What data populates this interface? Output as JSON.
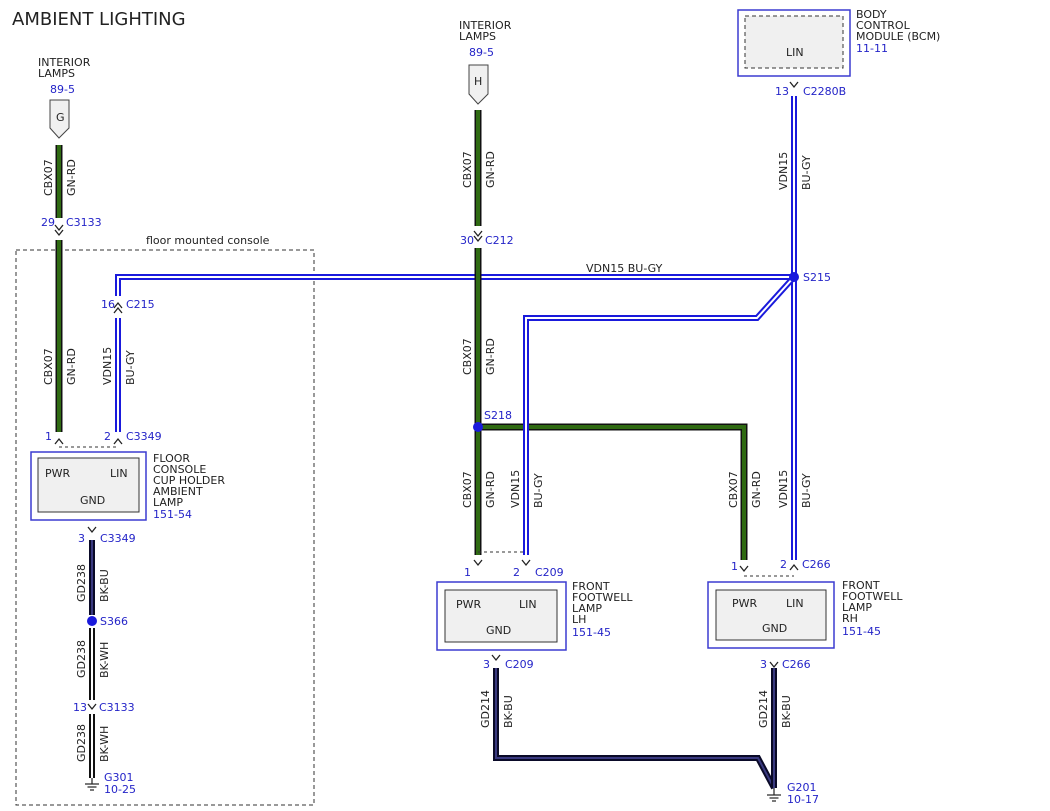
{
  "title": "AMBIENT LIGHTING",
  "colors": {
    "green_red_wire": "#2f6a12",
    "blue_gray_wire": "#1a1adc",
    "black_wire": "#0a0a28",
    "ref_blue": "#2424c8",
    "box_fill": "#f0f0f0",
    "module_border": "#3b3bd0"
  },
  "console_region": {
    "label": "floor mounted console"
  },
  "sources": {
    "left": {
      "name_line1": "INTERIOR",
      "name_line2": "LAMPS",
      "ref": "89-5",
      "pin": "G"
    },
    "mid": {
      "name_line1": "INTERIOR",
      "name_line2": "LAMPS",
      "ref": "89-5",
      "pin": "H"
    },
    "bcm": {
      "name_line1": "BODY",
      "name_line2": "CONTROL",
      "name_line3": "MODULE (BCM)",
      "ref": "11-11",
      "pin": "LIN"
    }
  },
  "connectors": {
    "c3133_top": {
      "pin": "29",
      "name": "C3133"
    },
    "c212": {
      "pin": "30",
      "name": "C212"
    },
    "c2280b": {
      "pin": "13",
      "name": "C2280B"
    },
    "c215": {
      "pin": "16",
      "name": "C215"
    },
    "c3349_pwr": {
      "pin": "1"
    },
    "c3349_lin": {
      "pin": "2",
      "name": "C3349"
    },
    "c3349_gnd": {
      "pin": "3",
      "name": "C3349"
    },
    "c209_pwr": {
      "pin": "1"
    },
    "c209_lin": {
      "pin": "2",
      "name": "C209"
    },
    "c209_gnd": {
      "pin": "3",
      "name": "C209"
    },
    "c266_pwr": {
      "pin": "1"
    },
    "c266_lin": {
      "pin": "2",
      "name": "C266"
    },
    "c266_gnd": {
      "pin": "3",
      "name": "C266"
    },
    "c3133_bot": {
      "pin": "13",
      "name": "C3133"
    }
  },
  "splices": {
    "s215": "S215",
    "s218": "S218",
    "s366": "S366"
  },
  "wires": {
    "cbx07": {
      "circuit": "CBX07",
      "color": "GN-RD"
    },
    "vdn15": {
      "circuit": "VDN15",
      "color": "BU-GY"
    },
    "gd238_bu": {
      "circuit": "GD238",
      "color": "BK-BU"
    },
    "gd238_wh": {
      "circuit": "GD238",
      "color": "BK-WH"
    },
    "gd214": {
      "circuit": "GD214",
      "color": "BK-BU"
    },
    "vdn15_bus": "VDN15   BU-GY"
  },
  "components": {
    "floor_lamp": {
      "line1": "FLOOR",
      "line2": "CONSOLE",
      "line3": "CUP HOLDER",
      "line4": "AMBIENT",
      "line5": "LAMP",
      "ref": "151-54",
      "pwr": "PWR",
      "lin": "LIN",
      "gnd": "GND"
    },
    "footwell_lh": {
      "line1": "FRONT",
      "line2": "FOOTWELL",
      "line3": "LAMP",
      "line4": "LH",
      "ref": "151-45",
      "pwr": "PWR",
      "lin": "LIN",
      "gnd": "GND"
    },
    "footwell_rh": {
      "line1": "FRONT",
      "line2": "FOOTWELL",
      "line3": "LAMP",
      "line4": "RH",
      "ref": "151-45",
      "pwr": "PWR",
      "lin": "LIN",
      "gnd": "GND"
    }
  },
  "grounds": {
    "g301": {
      "name": "G301",
      "ref": "10-25"
    },
    "g201": {
      "name": "G201",
      "ref": "10-17"
    }
  }
}
